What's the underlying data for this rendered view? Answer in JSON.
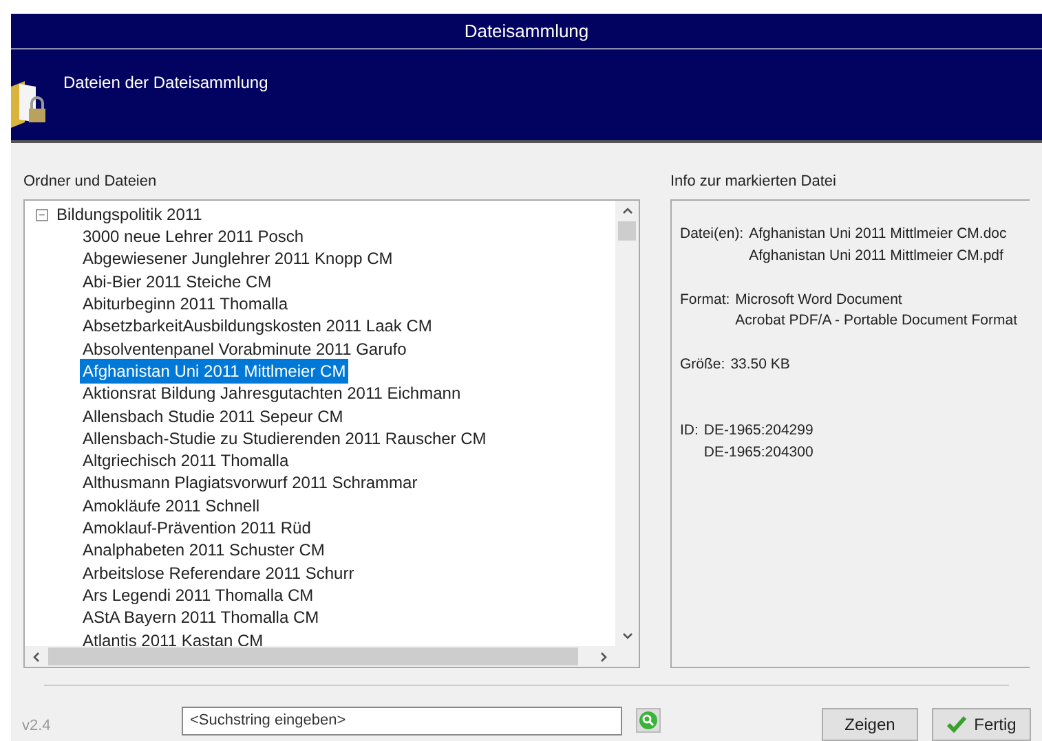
{
  "window": {
    "title": "Dateisammlung"
  },
  "header": {
    "subtitle": "Dateien der Dateisammlung"
  },
  "tree_panel": {
    "label": "Ordner und Dateien",
    "folder": {
      "name": "Bildungspolitik 2011",
      "expanded": true,
      "expander": "−",
      "children": [
        {
          "name": "3000 neue Lehrer 2011 Posch",
          "selected": false
        },
        {
          "name": "Abgewiesener Junglehrer 2011 Knopp CM",
          "selected": false
        },
        {
          "name": "Abi-Bier 2011 Steiche CM",
          "selected": false
        },
        {
          "name": "Abiturbeginn 2011 Thomalla",
          "selected": false
        },
        {
          "name": "AbsetzbarkeitAusbildungskosten 2011 Laak CM",
          "selected": false
        },
        {
          "name": "Absolventenpanel Vorabminute 2011 Garufo",
          "selected": false
        },
        {
          "name": "Afghanistan Uni 2011 Mittlmeier CM",
          "selected": true
        },
        {
          "name": "Aktionsrat Bildung Jahresgutachten 2011 Eichmann",
          "selected": false
        },
        {
          "name": "Allensbach Studie 2011 Sepeur CM",
          "selected": false
        },
        {
          "name": "Allensbach-Studie zu Studierenden 2011 Rauscher CM",
          "selected": false
        },
        {
          "name": "Altgriechisch 2011 Thomalla",
          "selected": false
        },
        {
          "name": "Althusmann Plagiatsvorwurf 2011 Schrammar",
          "selected": false
        },
        {
          "name": "Amokläufe 2011 Schnell",
          "selected": false
        },
        {
          "name": "Amoklauf-Prävention 2011 Rüd",
          "selected": false
        },
        {
          "name": "Analphabeten 2011 Schuster CM",
          "selected": false
        },
        {
          "name": "Arbeitslose Referendare 2011 Schurr",
          "selected": false
        },
        {
          "name": "Ars Legendi 2011 Thomalla CM",
          "selected": false
        },
        {
          "name": "AStA Bayern 2011 Thomalla CM",
          "selected": false
        },
        {
          "name": "Atlantis 2011 Kastan CM",
          "selected": false
        }
      ]
    }
  },
  "info_panel": {
    "label": "Info zur markierten Datei",
    "fields": [
      {
        "label": "Datei(en):",
        "values": [
          "Afghanistan Uni 2011 Mittlmeier CM.doc",
          "Afghanistan Uni 2011 Mittlmeier CM.pdf"
        ]
      },
      {
        "label": "Format:",
        "values": [
          "Microsoft Word Document",
          "Acrobat PDF/A - Portable Document Format"
        ]
      },
      {
        "label": "Größe:",
        "values": [
          "33.50 KB"
        ]
      },
      {
        "label": "ID:",
        "values": [
          "DE-1965:204299",
          "DE-1965:204300"
        ]
      }
    ]
  },
  "footer": {
    "version": "v2.4",
    "search": {
      "placeholder": "<Suchstring eingeben>"
    },
    "buttons": [
      {
        "label": "Zeigen",
        "kind": "plain"
      },
      {
        "label": "Fertig",
        "kind": "confirm"
      }
    ]
  }
}
